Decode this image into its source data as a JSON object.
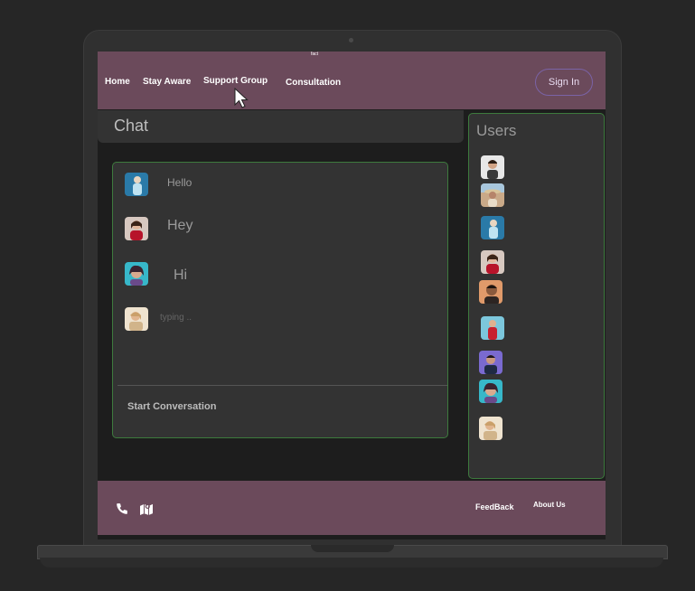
{
  "nav": {
    "logo_text": "fact",
    "home": "Home",
    "stay_aware": "Stay Aware",
    "support_group": "Support Group",
    "consultation": "Consultation",
    "sign_in": "Sign In"
  },
  "chat": {
    "title": "Chat",
    "messages": [
      {
        "text": "Hello",
        "avatar": "avatar-blue-figure"
      },
      {
        "text": "Hey",
        "avatar": "avatar-woman-red"
      },
      {
        "text": "Hi",
        "avatar": "avatar-woman-teal"
      }
    ],
    "typing": "typing ..",
    "start_conversation": "Start Conversation"
  },
  "users": {
    "title": "Users",
    "list": [
      {
        "avatar": "avatar-man-white"
      },
      {
        "avatar": "avatar-person-hat"
      },
      {
        "avatar": "avatar-blue-figure"
      },
      {
        "avatar": "avatar-woman-red"
      },
      {
        "avatar": "avatar-man-orange"
      },
      {
        "avatar": "avatar-red-figure"
      },
      {
        "avatar": "avatar-man-purple"
      },
      {
        "avatar": "avatar-woman-teal"
      },
      {
        "avatar": "avatar-woman-beige"
      }
    ]
  },
  "footer": {
    "phone_icon": "phone-icon",
    "map_icon": "map-icon",
    "feedback": "FeedBack",
    "about_us": "About Us"
  },
  "colors": {
    "nav_bg": "#6b4a5b",
    "panel_bg": "#333333",
    "panel_border": "#3d7a3d",
    "screen_bg": "#1d1d1d"
  }
}
